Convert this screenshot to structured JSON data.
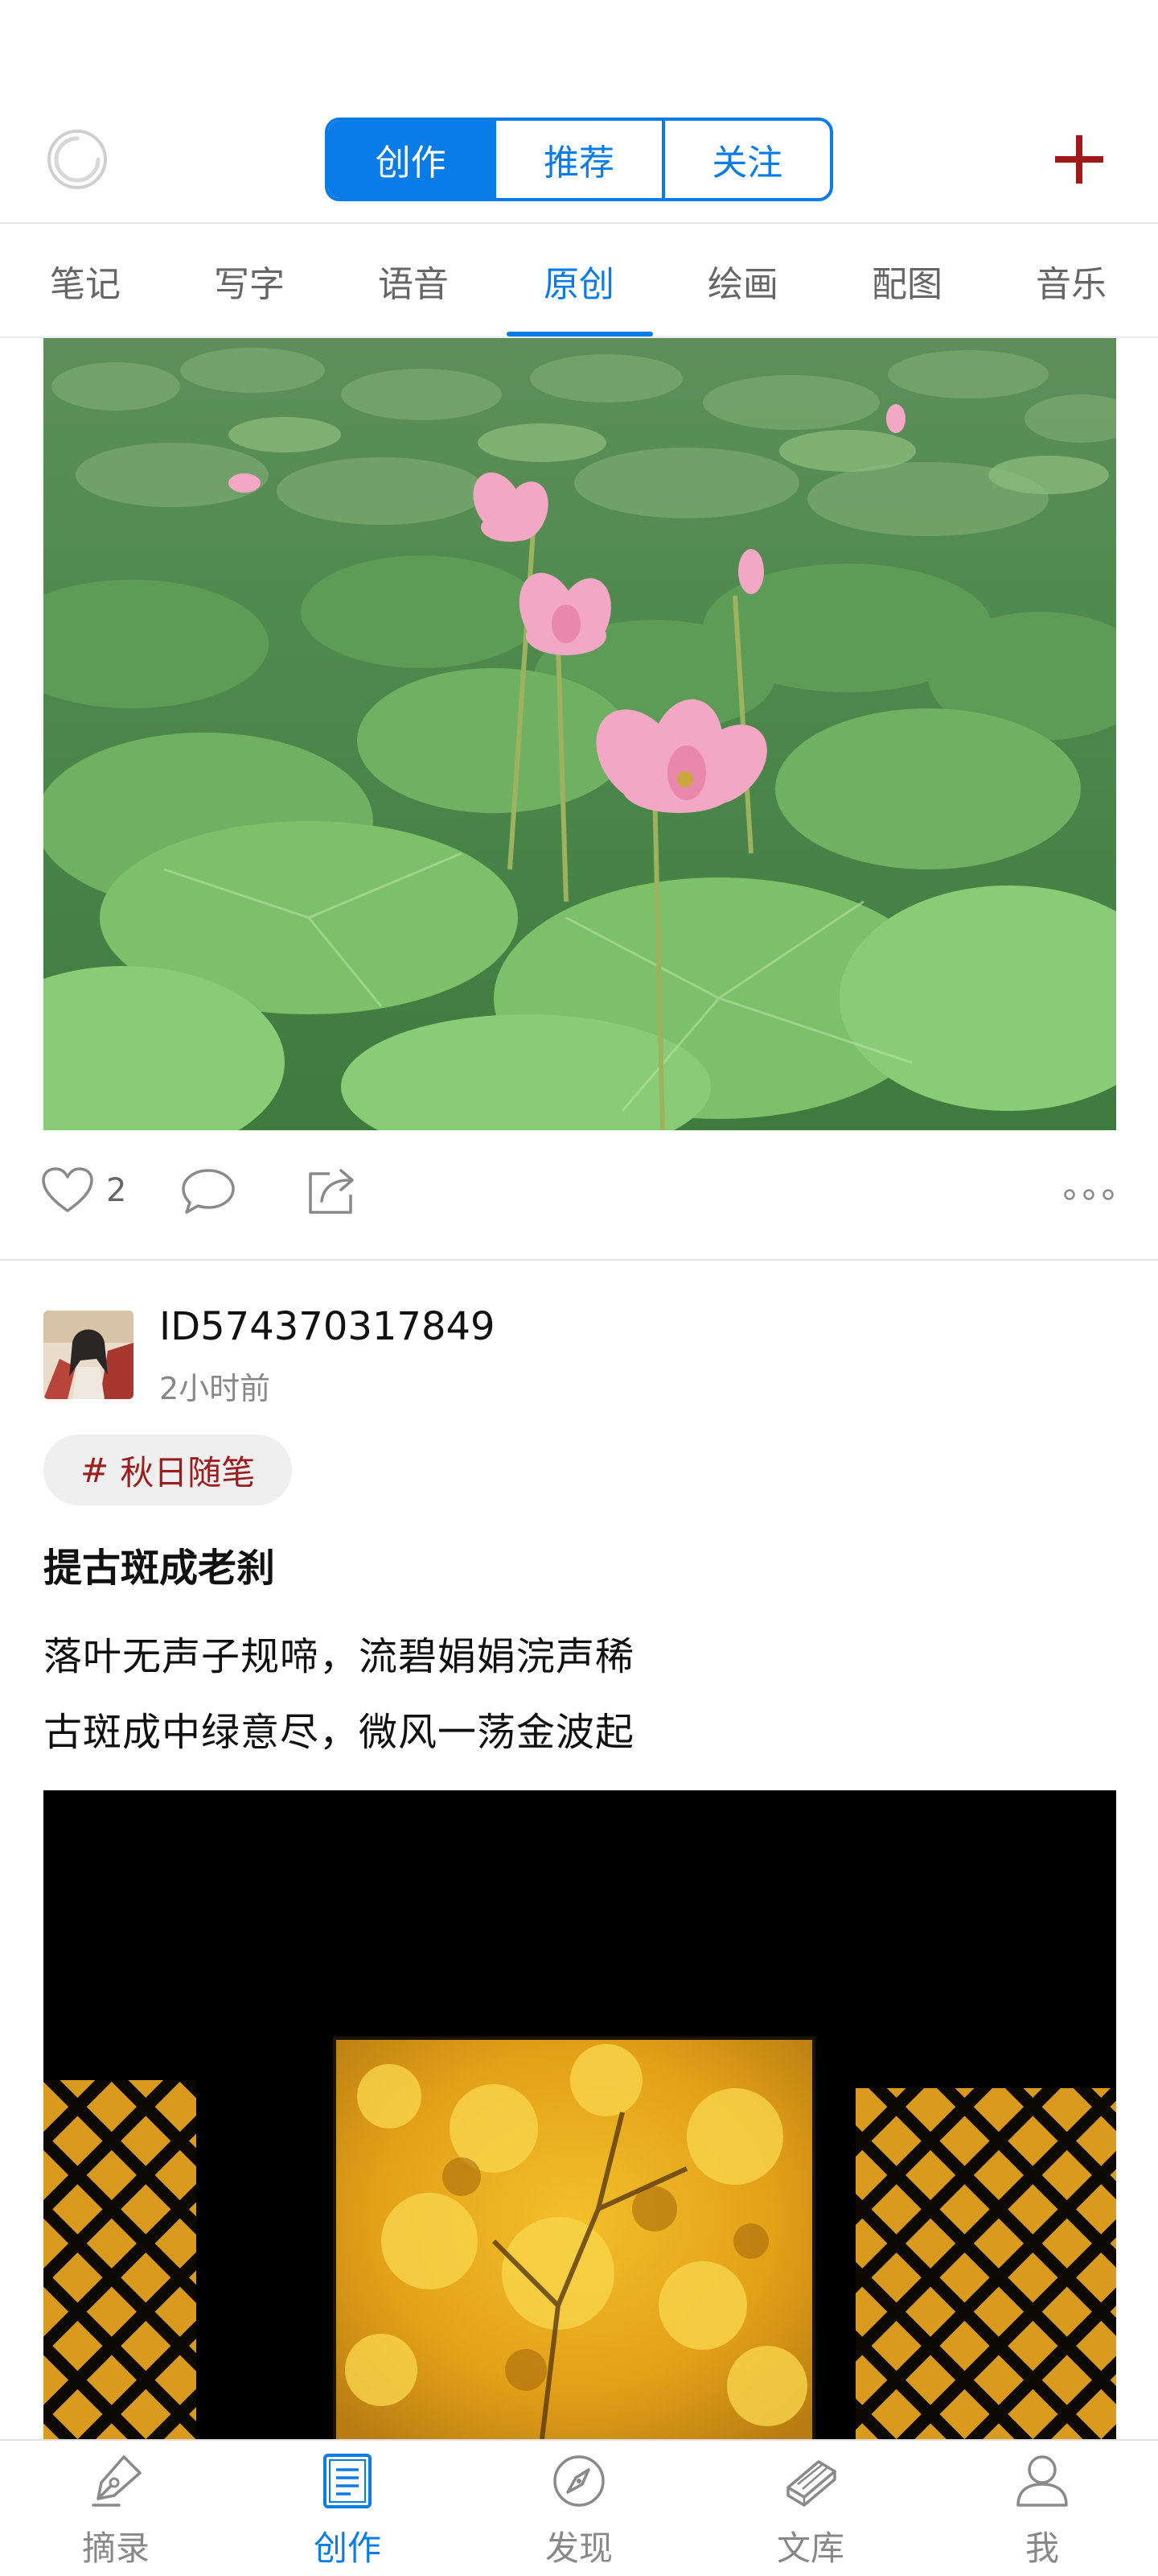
{
  "header": {
    "segments": [
      {
        "label": "创作",
        "active": true
      },
      {
        "label": "推荐",
        "active": false
      },
      {
        "label": "关注",
        "active": false
      }
    ],
    "icons": {
      "left": "refresh-icon",
      "right": "plus-icon"
    }
  },
  "categories": {
    "items": [
      "笔记",
      "写字",
      "语音",
      "原创",
      "绘画",
      "配图",
      "音乐"
    ],
    "active": "原创"
  },
  "post1": {
    "image": "lotus-pond-photo",
    "like_count": "2",
    "icons": [
      "heart-icon",
      "comment-icon",
      "share-icon",
      "more-icon"
    ]
  },
  "post2": {
    "username": "ID574370317849",
    "time": "2小时前",
    "topic_hash": "#",
    "topic": "秋日随笔",
    "title": "提古斑成老刹",
    "lines": [
      "落叶无声子规啼，流碧娟娟浣声稀",
      "古斑成中绿意尽，微风一荡金波起"
    ],
    "image": "autumn-ginkgo-window-photo"
  },
  "bottom_nav": {
    "items": [
      {
        "label": "摘录",
        "icon": "pen-nib-icon",
        "active": false
      },
      {
        "label": "创作",
        "icon": "document-icon",
        "active": true
      },
      {
        "label": "发现",
        "icon": "compass-icon",
        "active": false
      },
      {
        "label": "文库",
        "icon": "book-icon",
        "active": false
      },
      {
        "label": "我",
        "icon": "person-icon",
        "active": false
      }
    ]
  },
  "colors": {
    "accent": "#0a7ce8",
    "topic_text": "#9b1d1d",
    "plus": "#a01818",
    "muted": "#888888"
  }
}
